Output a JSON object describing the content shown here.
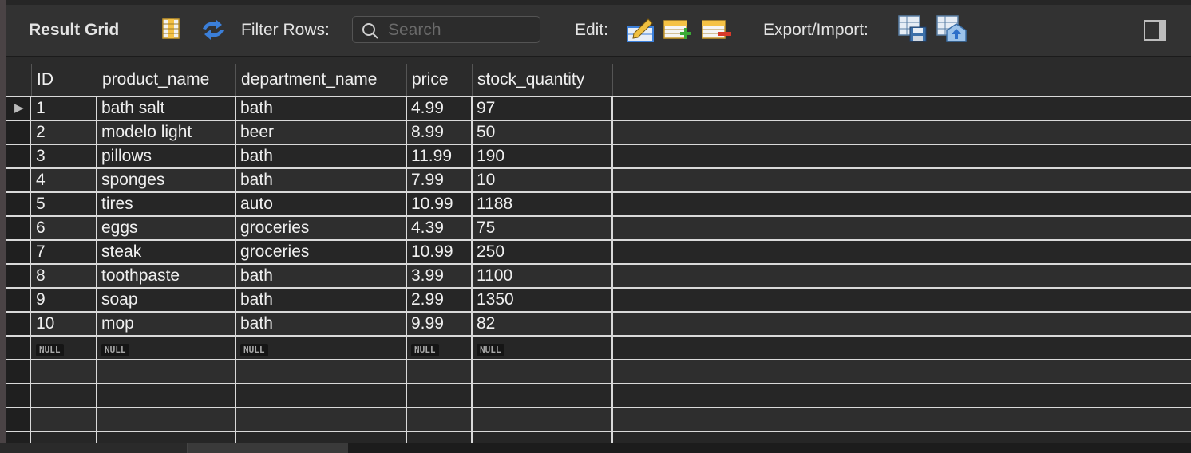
{
  "toolbar": {
    "title": "Result Grid",
    "filter_label": "Filter Rows:",
    "search_placeholder": "Search",
    "edit_label": "Edit:",
    "export_label": "Export/Import:"
  },
  "columns": [
    "ID",
    "product_name",
    "department_name",
    "price",
    "stock_quantity"
  ],
  "rows": [
    [
      "1",
      "bath salt",
      "bath",
      "4.99",
      "97"
    ],
    [
      "2",
      "modelo light",
      "beer",
      "8.99",
      "50"
    ],
    [
      "3",
      "pillows",
      "bath",
      "11.99",
      "190"
    ],
    [
      "4",
      "sponges",
      "bath",
      "7.99",
      "10"
    ],
    [
      "5",
      "tires",
      "auto",
      "10.99",
      "1188"
    ],
    [
      "6",
      "eggs",
      "groceries",
      "4.39",
      "75"
    ],
    [
      "7",
      "steak",
      "groceries",
      "10.99",
      "250"
    ],
    [
      "8",
      "toothpaste",
      "bath",
      "3.99",
      "1100"
    ],
    [
      "9",
      "soap",
      "bath",
      "2.99",
      "1350"
    ],
    [
      "10",
      "mop",
      "bath",
      "9.99",
      "82"
    ]
  ],
  "null_label": "NULL",
  "icons": [
    "grid-icon",
    "refresh-icon",
    "search-icon",
    "edit-cell-icon",
    "add-row-icon",
    "delete-row-icon",
    "export-icon",
    "import-icon",
    "panel-toggle-icon"
  ],
  "colors": {
    "background": "#2b2b2b",
    "toolbar": "#323232",
    "gridline": "#d9d9d9",
    "accent_blue": "#3b7fd9"
  }
}
